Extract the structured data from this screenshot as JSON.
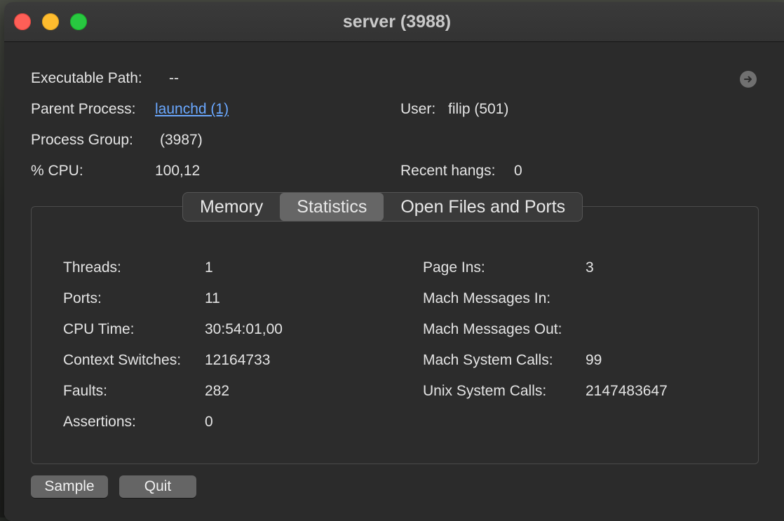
{
  "window": {
    "title": "server (3988)"
  },
  "info": {
    "executable_path_label": "Executable Path:",
    "executable_path_value": "--",
    "parent_process_label": "Parent Process:",
    "parent_process_value": "launchd (1)",
    "user_label": "User:",
    "user_value": "filip (501)",
    "process_group_label": "Process Group:",
    "process_group_value": "(3987)",
    "cpu_label": "% CPU:",
    "cpu_value": "100,12",
    "recent_hangs_label": "Recent hangs:",
    "recent_hangs_value": "0",
    "reveal_icon": "arrow-right-circle-icon"
  },
  "tabs": [
    {
      "label": "Memory",
      "active": false
    },
    {
      "label": "Statistics",
      "active": true
    },
    {
      "label": "Open Files and Ports",
      "active": false
    }
  ],
  "statistics": {
    "left": [
      {
        "label": "Threads:",
        "value": "1"
      },
      {
        "label": "Ports:",
        "value": "11"
      },
      {
        "label": "CPU Time:",
        "value": "30:54:01,00"
      },
      {
        "label": "Context Switches:",
        "value": "12164733"
      },
      {
        "label": "Faults:",
        "value": "282"
      },
      {
        "label": "Assertions:",
        "value": "0"
      }
    ],
    "right": [
      {
        "label": "Page Ins:",
        "value": "3"
      },
      {
        "label": "Mach Messages In:",
        "value": ""
      },
      {
        "label": "Mach Messages Out:",
        "value": ""
      },
      {
        "label": "Mach System Calls:",
        "value": "99"
      },
      {
        "label": "Unix System Calls:",
        "value": "2147483647"
      }
    ]
  },
  "buttons": {
    "sample_label": "Sample",
    "quit_label": "Quit"
  },
  "colors": {
    "close": "#fe5f57",
    "minimize": "#febc2e",
    "maximize": "#28c840",
    "link": "#6aa8ff"
  }
}
